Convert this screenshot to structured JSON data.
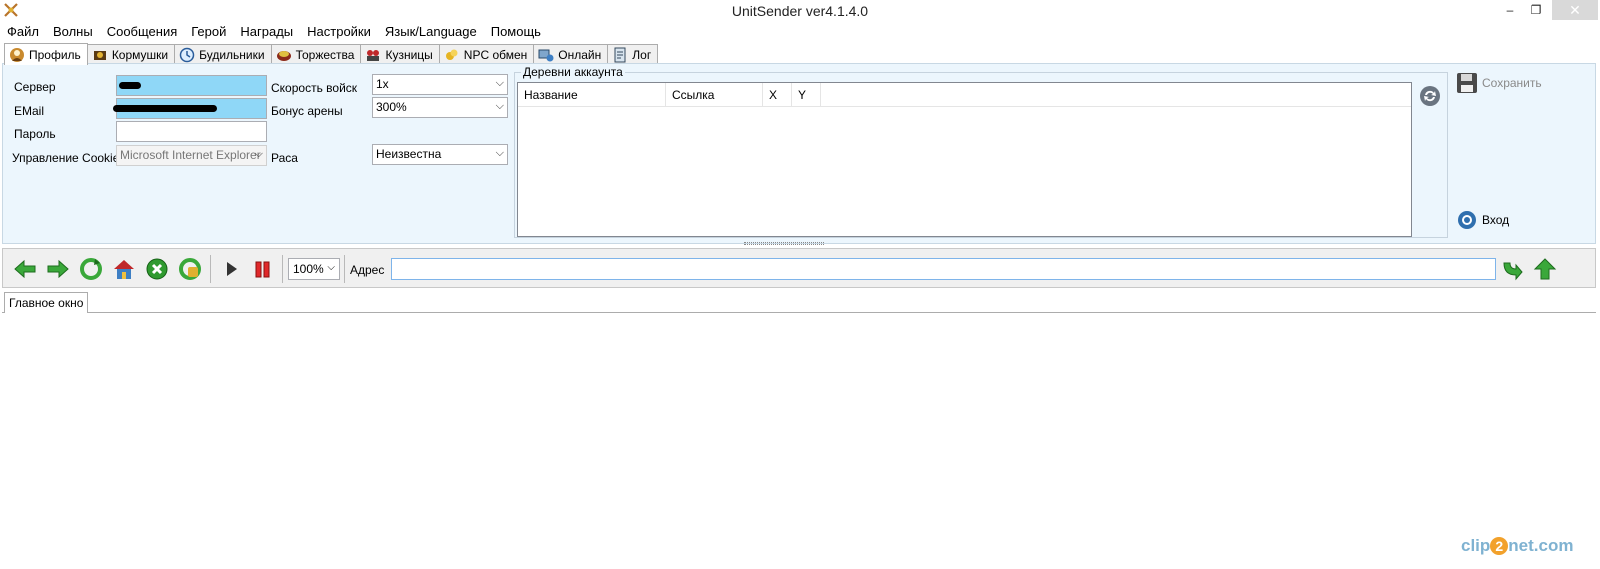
{
  "window": {
    "title": "UnitSender ver4.1.4.0",
    "min_glyph": "–",
    "max_glyph": "❐",
    "close_glyph": "✕"
  },
  "menu": [
    "Файл",
    "Волны",
    "Сообщения",
    "Герой",
    "Награды",
    "Настройки",
    "Язык/Language",
    "Помощь"
  ],
  "tabs": [
    {
      "label": "Профиль",
      "icon": "profile-icon",
      "active": true
    },
    {
      "label": "Кормушки",
      "icon": "feeder-icon",
      "active": false
    },
    {
      "label": "Будильники",
      "icon": "alarm-icon",
      "active": false
    },
    {
      "label": "Торжества",
      "icon": "celebration-icon",
      "active": false
    },
    {
      "label": "Кузницы",
      "icon": "smithy-icon",
      "active": false
    },
    {
      "label": "NPC обмен",
      "icon": "npc-exchange-icon",
      "active": false
    },
    {
      "label": "Онлайн",
      "icon": "online-icon",
      "active": false
    },
    {
      "label": "Лог",
      "icon": "log-icon",
      "active": false
    }
  ],
  "profile": {
    "server_label": "Сервер",
    "email_label": "EMail",
    "password_label": "Пароль",
    "cookies_label": "Управление Cookies",
    "cookies_value": "Microsoft Internet Explorer",
    "troop_speed_label": "Скорость войск",
    "troop_speed_value": "1x",
    "arena_bonus_label": "Бонус арены",
    "arena_bonus_value": "300%",
    "race_label": "Раса",
    "race_value": "Неизвестна"
  },
  "villages": {
    "title": "Деревни аккаунта",
    "columns": [
      "Название",
      "Ссылка",
      "X",
      "Y"
    ]
  },
  "actions": {
    "save_label": "Сохранить",
    "login_label": "Вход"
  },
  "browser": {
    "zoom_value": "100%",
    "address_label": "Адрес",
    "address_value": ""
  },
  "bottom_tabs": [
    "Главное окно"
  ],
  "watermark": {
    "left": "clip",
    "mid": "2",
    "right": "net.com"
  },
  "colors": {
    "panel_bg": "#ecf6fd",
    "input_highlight": "#8fd7f7",
    "arrow_green": "#3aa83a"
  }
}
